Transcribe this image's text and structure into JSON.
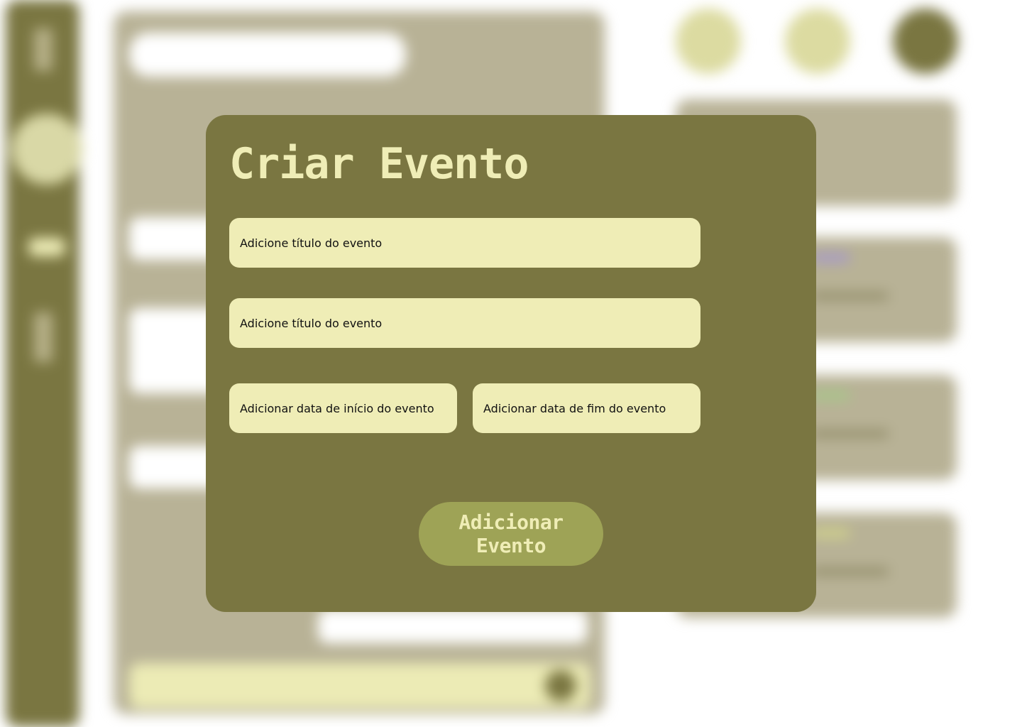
{
  "colors": {
    "primary": "#7a7641",
    "field": "#efedb6",
    "button": "#9ea356",
    "panel": "#b8b296"
  },
  "modal": {
    "title": "Criar Evento",
    "fields": {
      "title_1_placeholder": "Adicione título do evento",
      "title_2_placeholder": "Adicione título do evento",
      "start_date_placeholder": "Adicionar data de início do evento",
      "end_date_placeholder": "Adicionar data de fim do evento"
    },
    "submit_label": "Adicionar Evento"
  }
}
